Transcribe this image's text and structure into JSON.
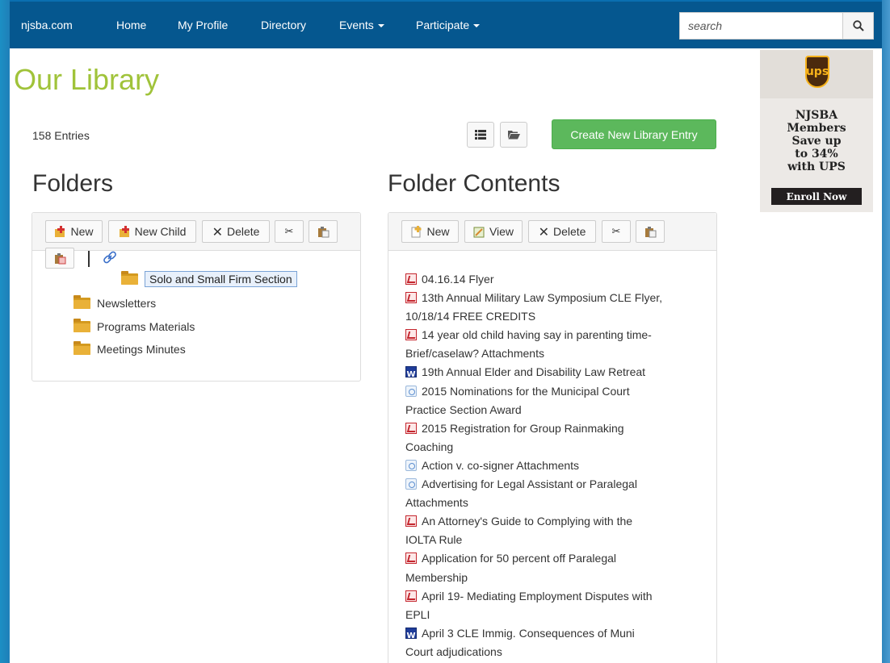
{
  "nav": {
    "brand": "njsba.com",
    "items": [
      "Home",
      "My Profile",
      "Directory",
      "Events",
      "Participate"
    ],
    "search_placeholder": "search"
  },
  "library": {
    "title": "Our Library",
    "entries_count": "158 Entries",
    "create_button": "Create New Library Entry"
  },
  "folders": {
    "heading": "Folders",
    "toolbar": {
      "new": "New",
      "new_child": "New Child",
      "delete": "Delete"
    },
    "tree": [
      {
        "label": "Solo and Small Firm Section",
        "selected": true
      },
      {
        "label": "Newsletters"
      },
      {
        "label": "Programs Materials"
      },
      {
        "label": "Meetings Minutes"
      }
    ]
  },
  "contents": {
    "heading": "Folder Contents",
    "toolbar": {
      "new": "New",
      "view": "View",
      "delete": "Delete"
    },
    "files": [
      {
        "type": "pdf",
        "lines": [
          "04.16.14 Flyer"
        ]
      },
      {
        "type": "pdf",
        "lines": [
          "13th Annual Military Law Symposium CLE Flyer,",
          "10/18/14 FREE CREDITS"
        ]
      },
      {
        "type": "pdf",
        "lines": [
          "14 year old child having say in parenting time-",
          "Brief/caselaw? Attachments"
        ]
      },
      {
        "type": "doc",
        "lines": [
          "19th Annual Elder and Disability Law Retreat"
        ]
      },
      {
        "type": "link",
        "lines": [
          "2015 Nominations for the Municipal Court",
          "Practice Section Award"
        ]
      },
      {
        "type": "pdf",
        "lines": [
          "2015 Registration for Group Rainmaking",
          "Coaching"
        ]
      },
      {
        "type": "link",
        "lines": [
          "Action v. co-signer Attachments"
        ]
      },
      {
        "type": "link",
        "lines": [
          "Advertising for Legal Assistant or Paralegal",
          "Attachments"
        ]
      },
      {
        "type": "pdf",
        "lines": [
          "An Attorney's Guide to Complying with the",
          "IOLTA Rule"
        ]
      },
      {
        "type": "pdf",
        "lines": [
          "Application for 50 percent off Paralegal",
          "Membership"
        ]
      },
      {
        "type": "pdf",
        "lines": [
          "April 19- Mediating Employment Disputes with",
          "EPLI"
        ]
      },
      {
        "type": "doc",
        "lines": [
          "April 3 CLE Immig. Consequences of Muni",
          "Court adjudications"
        ]
      }
    ]
  },
  "ad": {
    "logo_text": "ups",
    "copy": [
      "NJSBA",
      "Members",
      "Save up",
      "to 34%",
      "with UPS"
    ],
    "cta": "Enroll Now"
  },
  "colors": {
    "navbar": "#05578f",
    "title_green": "#a0c33a",
    "create_button": "#5cb85c"
  }
}
